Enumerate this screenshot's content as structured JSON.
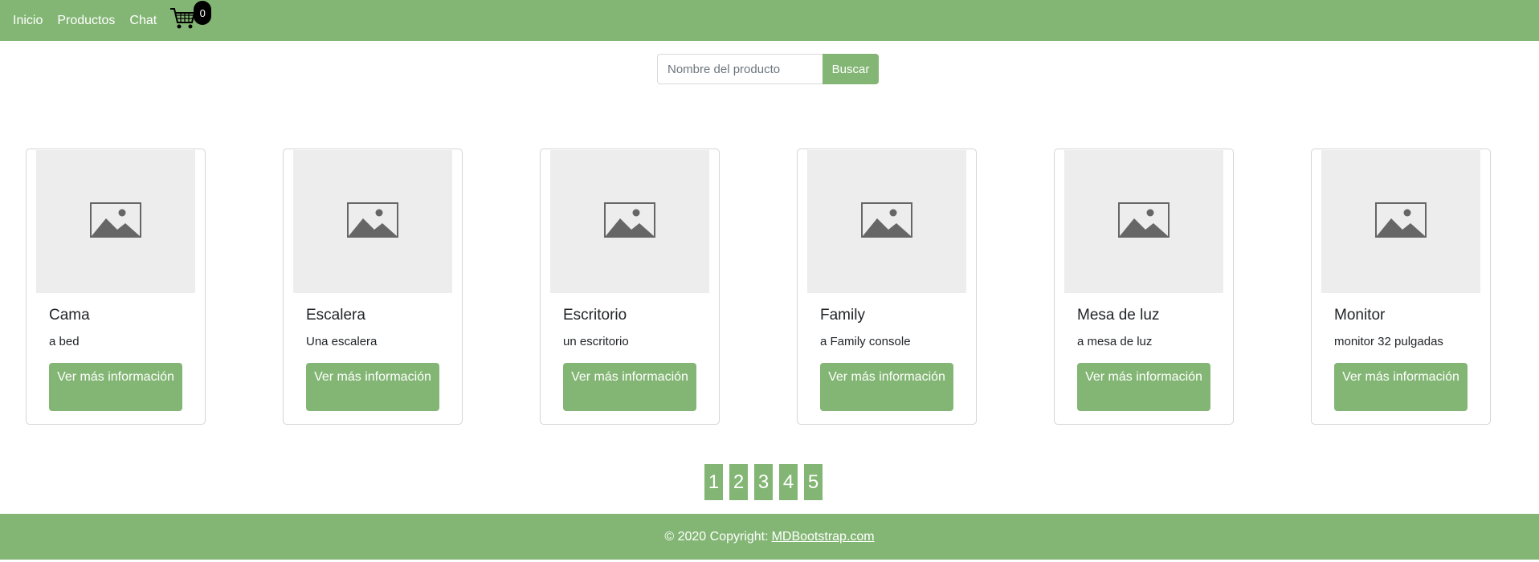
{
  "nav": {
    "links": [
      "Inicio",
      "Productos",
      "Chat"
    ],
    "cart_icon": "shopping-cart-icon",
    "cart_count": "0"
  },
  "search": {
    "placeholder": "Nombre del producto",
    "value": "",
    "button_label": "Buscar"
  },
  "products": [
    {
      "name": "Cama",
      "description": "a bed",
      "button_label": "Ver más información",
      "image_icon": "image-placeholder-icon"
    },
    {
      "name": "Escalera",
      "description": "Una escalera",
      "button_label": "Ver más información",
      "image_icon": "image-placeholder-icon"
    },
    {
      "name": "Escritorio",
      "description": "un escritorio",
      "button_label": "Ver más información",
      "image_icon": "image-placeholder-icon"
    },
    {
      "name": "Family",
      "description": "a Family console",
      "button_label": "Ver más información",
      "image_icon": "image-placeholder-icon"
    },
    {
      "name": "Mesa de luz",
      "description": "a mesa de luz",
      "button_label": "Ver más información",
      "image_icon": "image-placeholder-icon"
    },
    {
      "name": "Monitor",
      "description": "monitor 32 pulgadas",
      "button_label": "Ver más información",
      "image_icon": "image-placeholder-icon"
    }
  ],
  "pagination": [
    "1",
    "2",
    "3",
    "4",
    "5"
  ],
  "footer": {
    "text": "© 2020 Copyright:",
    "link": "MDBootstrap.com"
  },
  "colors": {
    "accent": "#83b674",
    "image_bg": "#ededed"
  }
}
